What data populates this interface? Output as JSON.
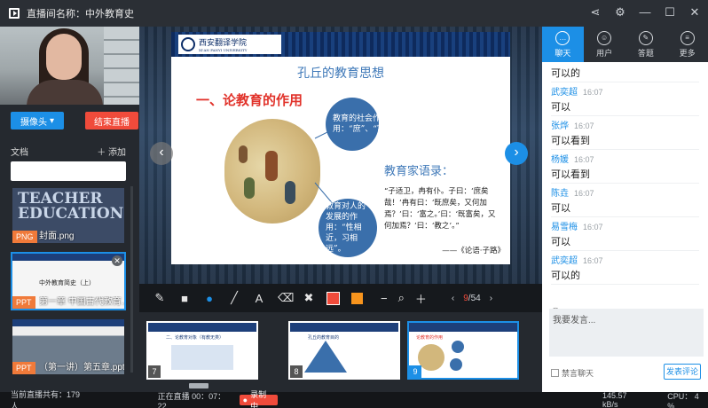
{
  "window": {
    "title": "直播间名称：中外教育史"
  },
  "left": {
    "camera_button": "摄像头",
    "end_live_button": "结束直播",
    "docs_label": "文档",
    "add_label": "添加",
    "docs": [
      {
        "tag": "PNG",
        "name": "封面.png",
        "cover_text": "TEACHER EDUCATION"
      },
      {
        "tag": "PPT",
        "name": "第一章 中国古代教育...",
        "thumb_text": "中外教育简史（上）"
      },
      {
        "tag": "PPT",
        "name": "（第一讲）第五章.pptx"
      }
    ]
  },
  "slide": {
    "logo_name": "西安翻译学院",
    "logo_sub": "XI'AN FANYI UNIVERSITY",
    "title": "孔丘的教育思想",
    "heading": "一、论教育的作用",
    "bubble1": "教育的社会作用：“庶”、“富”、“教”。",
    "bubble2": "教育对人的发展的作用：“性相近，习相远”。",
    "quote_title": "教育家语录：",
    "quote": "“子适卫，冉有仆。子曰：‘庶矣哉！’冉有曰：‘既庶矣，又何加焉？’曰：‘富之。’曰：‘既富矣，又何加焉？’曰：‘教之’。”",
    "quote_src": "——《论语·子路》"
  },
  "toolbar": {
    "page_current": "9",
    "page_total": "/54",
    "colors": {
      "red": "#f04b3b",
      "orange": "#f7941d",
      "blue": "#1c8fe6"
    }
  },
  "strip": {
    "thumbs": [
      {
        "num": "7",
        "text": "二、论教育对象（有教无类）"
      },
      {
        "num": "8",
        "text": "孔丘的教育目的"
      },
      {
        "num": "9",
        "text": "论教育的作用"
      }
    ]
  },
  "right": {
    "tabs": [
      "聊天",
      "用户",
      "答题",
      "更多"
    ],
    "messages": [
      {
        "user": "",
        "time": "",
        "content": "可以的"
      },
      {
        "user": "武奕超",
        "time": "16:07",
        "content": "可以"
      },
      {
        "user": "张烨",
        "time": "16:07",
        "content": "可以看到"
      },
      {
        "user": "杨媛",
        "time": "16:07",
        "content": "可以看到"
      },
      {
        "user": "陈垚",
        "time": "16:07",
        "content": "可以"
      },
      {
        "user": "易雪梅",
        "time": "16:07",
        "content": "可以"
      },
      {
        "user": "武奕超",
        "time": "16:07",
        "content": "可以的"
      }
    ],
    "compose_placeholder": "我要发言...",
    "ban_label": "禁言聊天",
    "send_label": "发表评论"
  },
  "status": {
    "viewers": "当前直播共有：179人",
    "live_time": "正在直播 00：07：22",
    "recording": "录制中",
    "speed": "145.57 kB/s",
    "cpu": "CPU： 4 %"
  }
}
